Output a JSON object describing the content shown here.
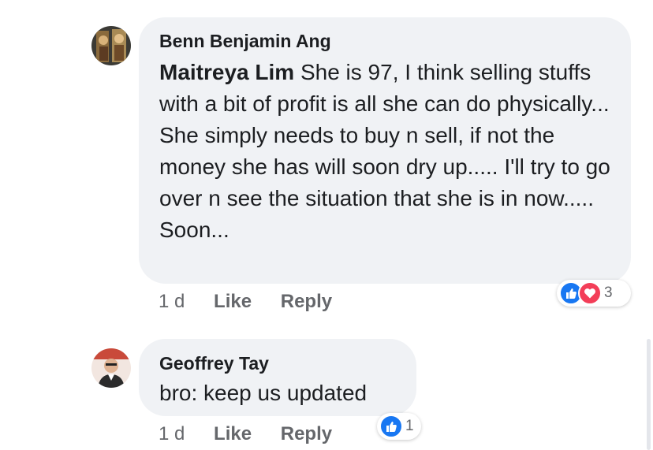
{
  "comments": [
    {
      "author": "Benn Benjamin Ang",
      "mention": "Maitreya Lim",
      "text": " She is 97, I think selling stuffs with a bit of profit is all she can do physically... She simply needs to buy n sell, if not the money she has will soon dry up..... I'll try to go over n see the situation that she is in now..... Soon...",
      "time": "1 d",
      "like_label": "Like",
      "reply_label": "Reply",
      "reaction_count": "3",
      "reactions": [
        "like-icon",
        "love-icon"
      ]
    },
    {
      "author": "Geoffrey Tay",
      "text": "bro: keep us updated",
      "time": "1 d",
      "like_label": "Like",
      "reply_label": "Reply",
      "reaction_count": "1",
      "reactions": [
        "like-icon"
      ]
    }
  ],
  "colors": {
    "bubble": "#f0f2f5",
    "like_blue": "#1877f2",
    "love_red": "#f33e58",
    "meta_gray": "#65676b"
  }
}
